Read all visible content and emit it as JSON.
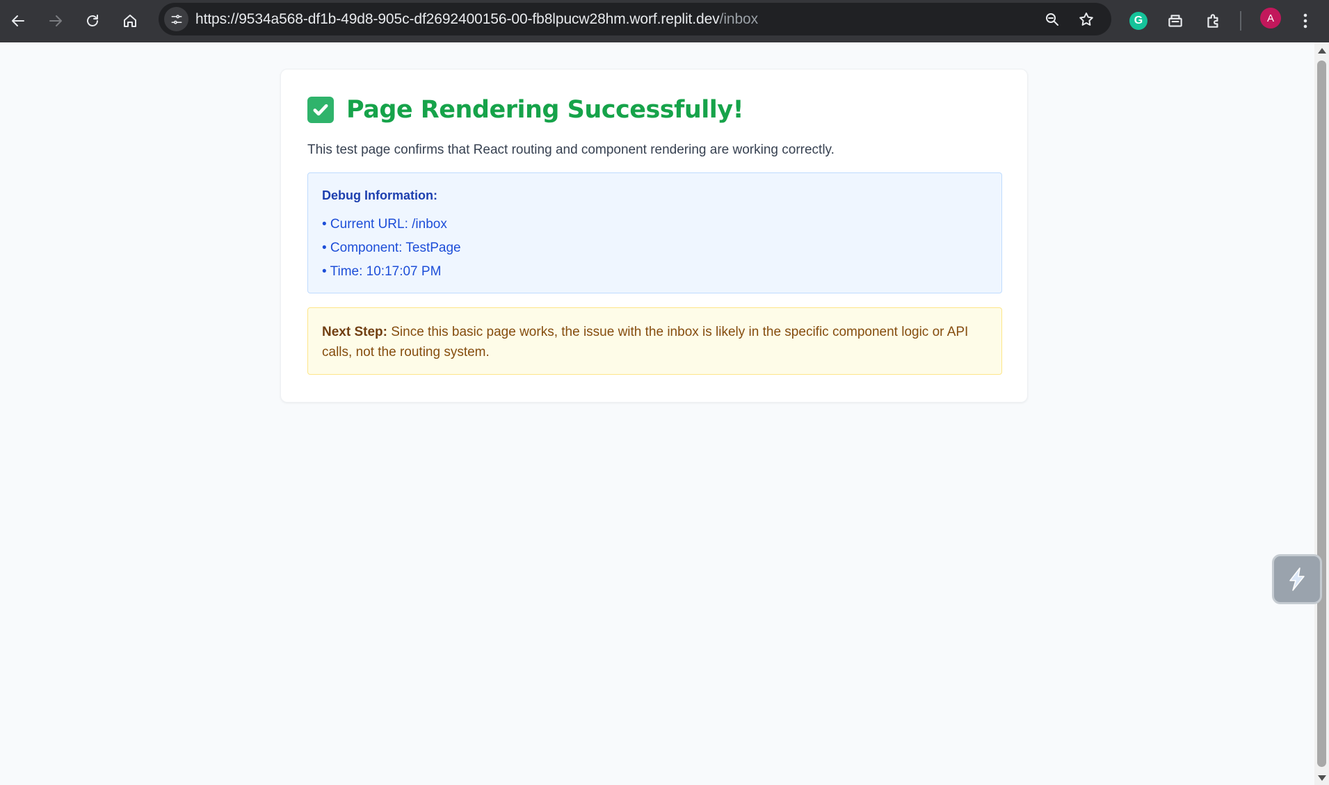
{
  "browser": {
    "url_host": "https://9534a568-df1b-49d8-905c-df2692400156-00-fb8lpucw28hm.worf.replit.dev",
    "url_path": "/inbox",
    "profile_initial": "A",
    "icons": {
      "back": "back-arrow-icon",
      "forward": "forward-arrow-icon",
      "reload": "reload-icon",
      "home": "home-icon",
      "site_info": "tune-icon",
      "zoom": "zoom-icon",
      "bookmark": "star-icon",
      "grammarly": "grammarly-icon",
      "extension2": "extension-icon",
      "extensions": "puzzle-icon",
      "menu": "kebab-menu-icon"
    }
  },
  "page": {
    "title": "Page Rendering Successfully!",
    "subtitle": "This test page confirms that React routing and component rendering are working correctly.",
    "debug": {
      "heading": "Debug Information:",
      "lines": [
        "• Current URL: /inbox",
        "• Component: TestPage",
        "• Time: 10:17:07 PM"
      ]
    },
    "next_step": {
      "label": "Next Step:",
      "text": " Since this basic page works, the issue with the inbox is likely in the specific component logic or API calls, not the routing system."
    }
  },
  "colors": {
    "title_green": "#16a34a",
    "debug_bg": "#eff6ff",
    "debug_text": "#1d4ed8",
    "next_bg": "#fefce8",
    "next_text": "#854d0e",
    "toolbar": "#35363a"
  }
}
